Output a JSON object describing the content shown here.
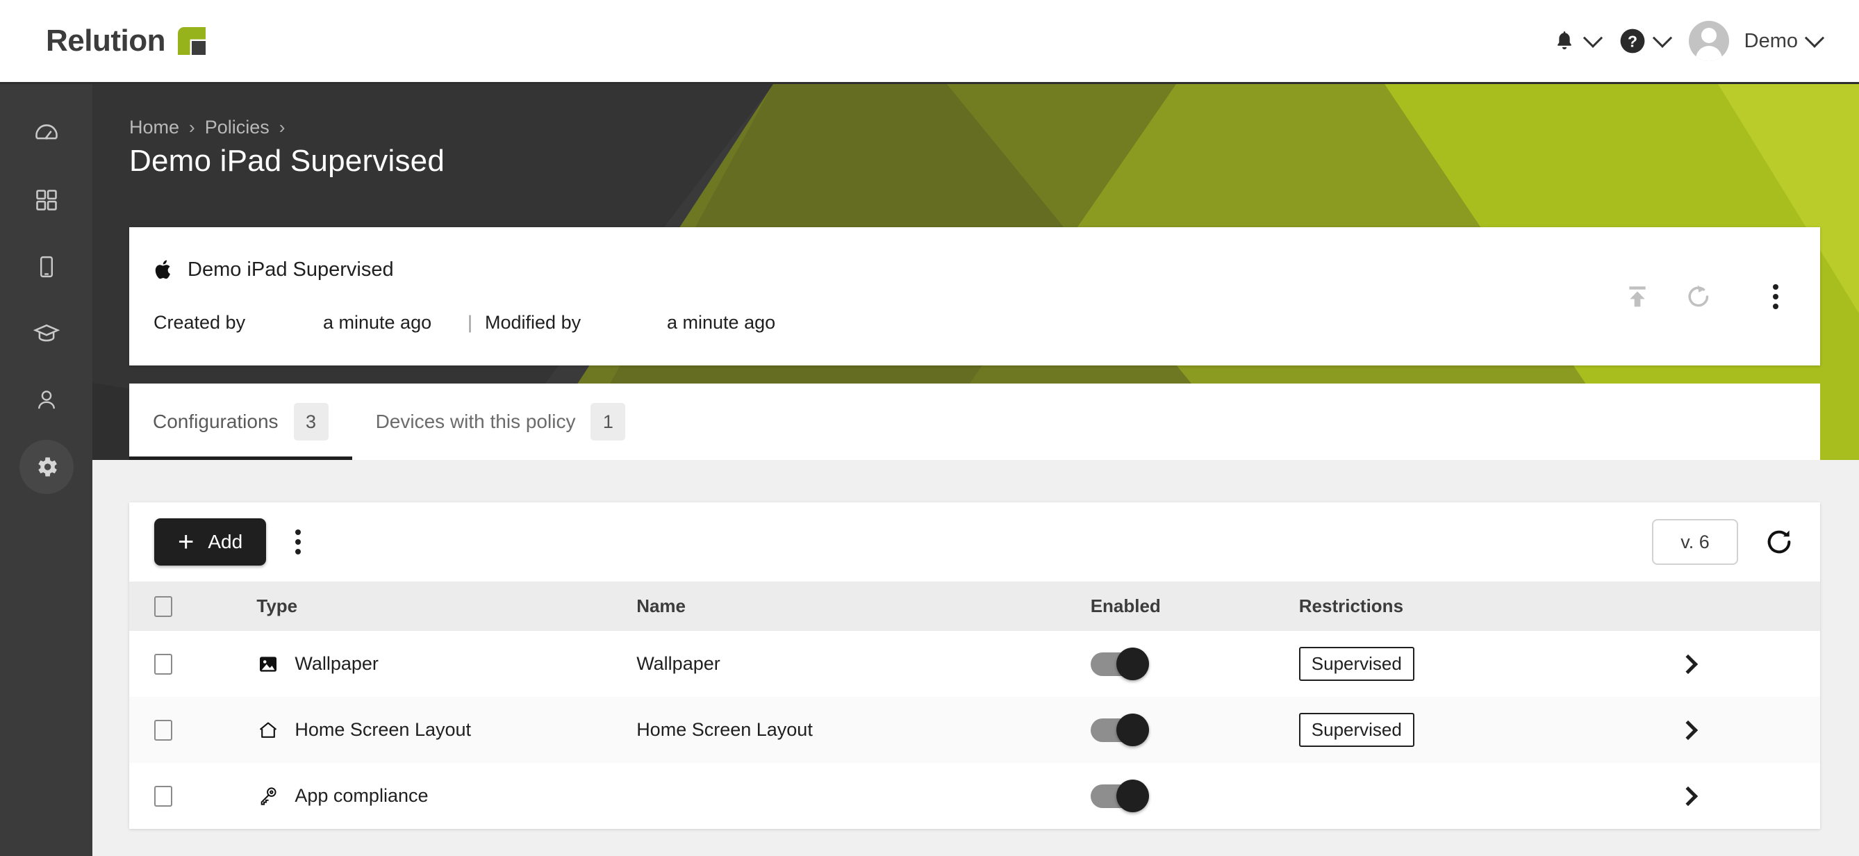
{
  "app": {
    "brand_name": "Relution",
    "brand_green": "#97b31b",
    "brand_dark": "#3c3c3c"
  },
  "topbar": {
    "notifications_icon": "bell-icon",
    "help_icon": "question-circle-icon",
    "avatar_icon": "avatar",
    "user_name": "Demo",
    "chevron_icon": "chevron-down-icon"
  },
  "sidebar": {
    "items": [
      {
        "icon": "dashboard-gauge-icon",
        "active": false
      },
      {
        "icon": "apps-grid-icon",
        "active": false
      },
      {
        "icon": "device-phone-icon",
        "active": false
      },
      {
        "icon": "graduation-cap-icon",
        "active": false
      },
      {
        "icon": "user-icon",
        "active": false
      },
      {
        "icon": "gear-icon",
        "active": true
      }
    ]
  },
  "header": {
    "breadcrumb": [
      "Home",
      "Policies"
    ],
    "separator": "›",
    "title": "Demo iPad Supervised"
  },
  "info_card": {
    "platform_icon": "apple-icon",
    "title": "Demo iPad Supervised",
    "created_by_label": "Created by",
    "created_by_value": "",
    "created_time": "a minute ago",
    "divider": "|",
    "modified_by_label": "Modified by",
    "modified_by_value": "",
    "modified_time": "a minute ago",
    "actions": [
      {
        "name": "publish-icon",
        "label": ""
      },
      {
        "name": "reset-icon",
        "label": ""
      },
      {
        "name": "more-vertical-icon",
        "label": ""
      }
    ]
  },
  "tabs": [
    {
      "label": "Configurations",
      "badge": "3",
      "active": true
    },
    {
      "label": "Devices with this policy",
      "badge": "1",
      "active": false
    }
  ],
  "toolbar": {
    "add_label": "Add",
    "add_plus": "+",
    "more_icon": "more-vertical-icon",
    "version_label": "v. 6",
    "refresh_icon": "refresh-icon"
  },
  "table": {
    "columns": [
      "Type",
      "Name",
      "Enabled",
      "Restrictions"
    ],
    "rows": [
      {
        "type": "Wallpaper",
        "type_icon": "image-icon",
        "name": "Wallpaper",
        "enabled": true,
        "restriction": "Supervised",
        "chevron": "chevron-right-icon"
      },
      {
        "type": "Home Screen Layout",
        "type_icon": "home-icon",
        "name": "Home Screen Layout",
        "enabled": true,
        "restriction": "Supervised",
        "chevron": "chevron-right-icon"
      },
      {
        "type": "App compliance",
        "type_icon": "key-icon",
        "name": "",
        "enabled": true,
        "restriction": "",
        "chevron": "chevron-right-icon"
      }
    ]
  },
  "colors": {
    "accent_green": "#97b31b",
    "sidebar_bg": "#3b3b3b",
    "page_bg": "#f0f0f0",
    "dark": "#1f1f1f"
  }
}
